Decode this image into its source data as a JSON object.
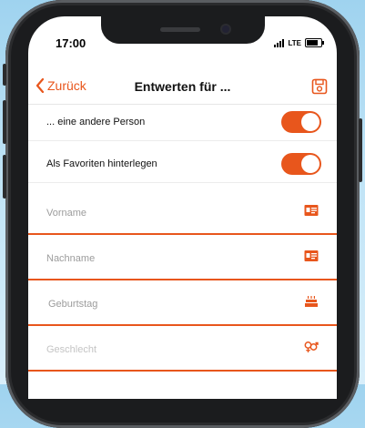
{
  "status": {
    "time": "17:00",
    "network": "LTE"
  },
  "navbar": {
    "back_label": "Zurück",
    "title": "Entwerten für ..."
  },
  "toggles": [
    {
      "label": "... eine andere Person",
      "on": true
    },
    {
      "label": "Als Favoriten hinterlegen",
      "on": true
    }
  ],
  "fields": [
    {
      "placeholder": "Vorname",
      "icon": "id-card-icon"
    },
    {
      "placeholder": "Nachname",
      "icon": "id-card-icon"
    },
    {
      "placeholder": "Geburtstag",
      "icon": "birthday-cake-icon"
    },
    {
      "placeholder": "Geschlecht",
      "icon": "gender-icon"
    }
  ],
  "colors": {
    "accent": "#e8561c",
    "background": "#bfe3f6"
  }
}
